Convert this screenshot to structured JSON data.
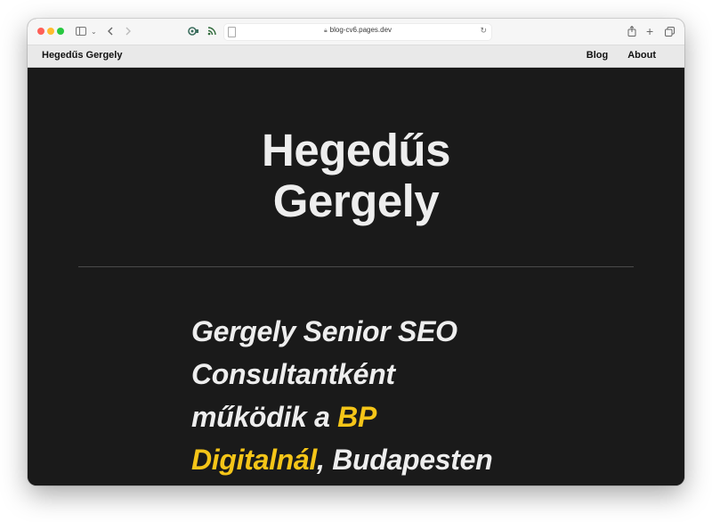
{
  "browser": {
    "url": "blog-cv6.pages.dev",
    "toolbar_icons": [
      "sidebar-toggle-icon",
      "chevron-down-icon",
      "back-icon",
      "forward-icon",
      "privacy-report-icon",
      "rss-icon",
      "reader-icon",
      "lock-icon",
      "reload-icon",
      "share-icon",
      "new-tab-icon",
      "tab-overview-icon"
    ]
  },
  "site": {
    "brand": "Hegedűs Gergely",
    "nav": [
      {
        "label": "Blog"
      },
      {
        "label": "About"
      }
    ]
  },
  "hero": {
    "title_line1": "Hegedűs",
    "title_line2": "Gergely"
  },
  "intro": {
    "part1": "Gergely Senior SEO Consultantként működik a ",
    "highlight": "BP Digitalnál",
    "part2": ", Budapesten",
    "highlight_color": "#f5c518"
  }
}
